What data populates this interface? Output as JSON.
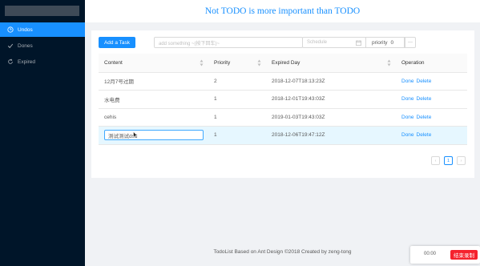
{
  "app": {
    "title": "Not TODO is more important than TODO"
  },
  "sidebar": {
    "items": [
      {
        "label": "Undos",
        "icon": "clock-icon",
        "active": true
      },
      {
        "label": "Dones",
        "icon": "check-icon",
        "active": false
      },
      {
        "label": "Expired",
        "icon": "refresh-icon",
        "active": false
      }
    ]
  },
  "toolbar": {
    "add_label": "Add a Task",
    "task_placeholder": "add something ~(按下回车)~",
    "schedule_placeholder": "Schedule",
    "priority_label": "priority",
    "priority_value": "0",
    "more_label": "···"
  },
  "table": {
    "headers": {
      "content": "Content",
      "priority": "Priority",
      "expired": "Expired Day",
      "operation": "Operation"
    },
    "rows": [
      {
        "content": "12月7号过期",
        "priority": "2",
        "expired": "2018-12-07T18:13:23Z",
        "done": "Done",
        "delete": "Delete"
      },
      {
        "content": "水电费",
        "priority": "1",
        "expired": "2018-12-01T19:43:03Z",
        "done": "Done",
        "delete": "Delete"
      },
      {
        "content": "cehis",
        "priority": "1",
        "expired": "2019-01-03T19:43:03Z",
        "done": "Done",
        "delete": "Delete"
      },
      {
        "content": "测试测试dsd",
        "priority": "1",
        "expired": "2018-12-06T19:47:12Z",
        "done": "Done",
        "delete": "Delete",
        "editing": true
      }
    ]
  },
  "pagination": {
    "prev": "‹",
    "current": "1",
    "next": "›"
  },
  "footer": {
    "text": "TodoList Based on Ant Design ©2018 Created by zeng-tong"
  },
  "recorder": {
    "time": "00:00",
    "stop_label": "结束录制"
  },
  "colors": {
    "primary": "#1890ff",
    "sider": "#001529",
    "danger": "#f5222d"
  }
}
